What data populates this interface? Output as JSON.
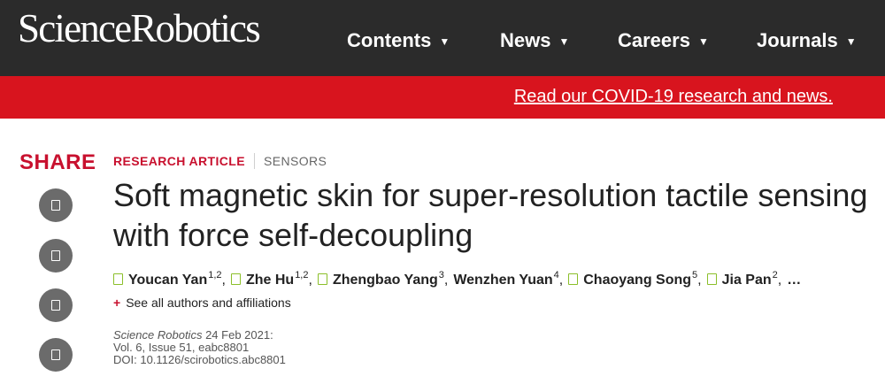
{
  "header": {
    "logo_part1": "Science",
    "logo_part2": "Robotics",
    "nav": [
      {
        "label": "Contents"
      },
      {
        "label": "News"
      },
      {
        "label": "Careers"
      },
      {
        "label": "Journals"
      }
    ]
  },
  "banner": {
    "text": "Read our COVID-19 research and news.",
    "color": "#d8141e"
  },
  "share": {
    "title": "SHARE",
    "buttons": [
      "share-icon",
      "share-icon",
      "share-icon",
      "share-icon"
    ]
  },
  "article": {
    "type": "RESEARCH ARTICLE",
    "subject": "SENSORS",
    "title": "Soft magnetic skin for super-resolution tactile sensing with force self-decoupling",
    "authors": [
      {
        "name": "Youcan Yan",
        "aff": "1,2",
        "orcid": true
      },
      {
        "name": "Zhe Hu",
        "aff": "1,2",
        "orcid": true
      },
      {
        "name": "Zhengbao Yang",
        "aff": "3",
        "orcid": true
      },
      {
        "name": "Wenzhen Yuan",
        "aff": "4",
        "orcid": false
      },
      {
        "name": "Chaoyang Song",
        "aff": "5",
        "orcid": true
      },
      {
        "name": "Jia Pan",
        "aff": "2",
        "orcid": true
      }
    ],
    "authors_more": "…",
    "see_all_plus": "+",
    "see_all": "See all authors and affiliations",
    "journal": "Science Robotics",
    "date": "24 Feb 2021:",
    "volume": "Vol. 6, Issue 51, eabc8801",
    "doi": "DOI: 10.1126/scirobotics.abc8801"
  },
  "colors": {
    "header_bg": "#2b2b2b",
    "accent_red": "#c8102e",
    "orcid_green": "#8bbf2a"
  }
}
